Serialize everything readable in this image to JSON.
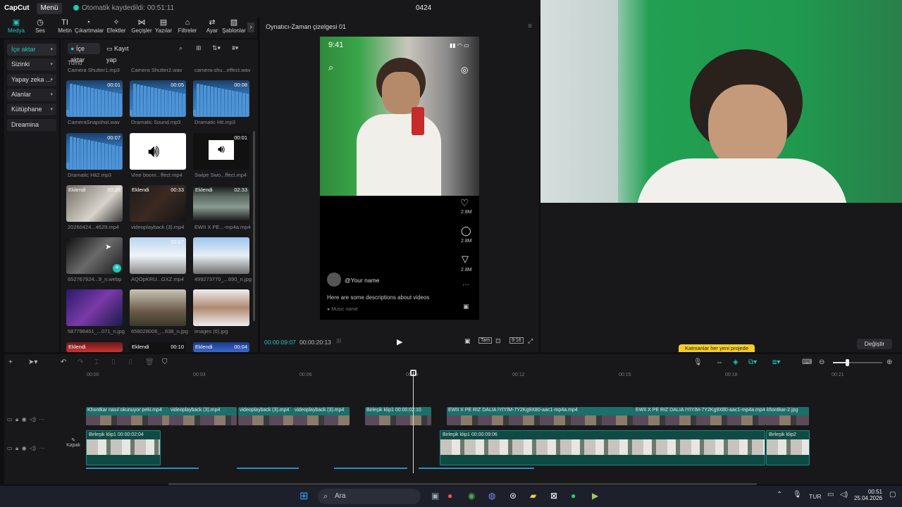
{
  "app": {
    "logo": "CapCut",
    "menu_label": "Menü",
    "autosave_text": "Otomatik kaydedildi: 00:51:11",
    "project_title": "0424"
  },
  "toolbar": {
    "tools": [
      {
        "label": "Medya",
        "icon": "media-icon",
        "glyph": "▣"
      },
      {
        "label": "Ses",
        "icon": "audio-icon",
        "glyph": "◷"
      },
      {
        "label": "Metin",
        "icon": "text-icon",
        "glyph": "TI"
      },
      {
        "label": "Çıkartmalar",
        "icon": "sticker-icon",
        "glyph": "◔"
      },
      {
        "label": "Efektler",
        "icon": "effects-icon",
        "glyph": "✧"
      },
      {
        "label": "Geçişler",
        "icon": "transitions-icon",
        "glyph": "⋈"
      },
      {
        "label": "Yazılar",
        "icon": "captions-icon",
        "glyph": "▤"
      },
      {
        "label": "Filtreler",
        "icon": "filters-icon",
        "glyph": "⌂"
      },
      {
        "label": "Ayar",
        "icon": "adjust-icon",
        "glyph": "⇄"
      },
      {
        "label": "Şablonlar",
        "icon": "templates-icon",
        "glyph": "▧"
      }
    ],
    "more_glyph": "›"
  },
  "leftnav": {
    "items": [
      {
        "label": "İçe aktar",
        "active": true
      },
      {
        "label": "Sizinki",
        "active": false
      },
      {
        "label": "Yapay zeka ...",
        "active": false
      },
      {
        "label": "Alanlar",
        "active": false
      },
      {
        "label": "Kütüphane",
        "active": false
      },
      {
        "label": "Dreamina",
        "active": false
      }
    ]
  },
  "media": {
    "import_label": "İçe aktar",
    "record_label": "Kayıt yap",
    "all_label": "Tümü",
    "top_names": [
      "Camera Shutter1.mp3",
      "Camera Shutter2.wav",
      "camera-shu...effect.wav"
    ],
    "items": [
      {
        "name": "CameraSnapshot.wav",
        "duration": "00:01",
        "kind": "wave",
        "added": ""
      },
      {
        "name": "Dramatic Sound.mp3",
        "duration": "00:05",
        "kind": "wave",
        "added": ""
      },
      {
        "name": "Dramatic Hit.mp3",
        "duration": "00:08",
        "kind": "wave",
        "added": ""
      },
      {
        "name": "Dramatic Hit2.mp3",
        "duration": "00:07",
        "kind": "wave",
        "added": ""
      },
      {
        "name": "Vine boom...ffect.mp4",
        "duration": "00:04",
        "kind": "speaker",
        "added": ""
      },
      {
        "name": "Swipe Swo...ffect.mp4",
        "duration": "00:01",
        "kind": "speaker-small",
        "added": ""
      },
      {
        "name": "20260424...4629.mp4",
        "duration": "00:26",
        "kind": "video-room",
        "added": "Eklendi"
      },
      {
        "name": "videoplayback (3).mp4",
        "duration": "00:33",
        "kind": "video-dark",
        "added": "Eklendi"
      },
      {
        "name": "EWII X PE...-mp4a.mp4",
        "duration": "02:33",
        "kind": "video-land",
        "added": "Eklendi"
      },
      {
        "name": "652767924...9_n.webp",
        "duration": "",
        "kind": "bw",
        "added": ""
      },
      {
        "name": "AQOpKRU...GXZ.mp4",
        "duration": "00:07",
        "kind": "snow",
        "added": ""
      },
      {
        "name": "499273770_...690_n.jpg",
        "duration": "",
        "kind": "snow2",
        "added": ""
      },
      {
        "name": "587798461_...071_n.jpg",
        "duration": "",
        "kind": "purple",
        "added": ""
      },
      {
        "name": "658028006_...638_n.jpg",
        "duration": "",
        "kind": "street",
        "added": ""
      },
      {
        "name": "images (6).jpg",
        "duration": "",
        "kind": "portrait",
        "added": ""
      },
      {
        "name": "",
        "duration": "",
        "kind": "red",
        "added": "Eklendi"
      },
      {
        "name": "",
        "duration": "00:10",
        "kind": "dark",
        "added": "Eklendi"
      },
      {
        "name": "",
        "duration": "00:04",
        "kind": "blue",
        "added": "Eklendi"
      }
    ]
  },
  "player": {
    "title": "Oynatıcı-Zaman çizelgesi 01",
    "phone_time": "9:41",
    "like_count": "2.8M",
    "comment_count": "2.8M",
    "share_count": "2.8M",
    "username": "@Your name",
    "description": "Here are some descriptions about videos",
    "music": "Music name",
    "current_time": "00:00:09:07",
    "total_time": "00:00:20:13",
    "controls": [
      "Tam",
      "9:16"
    ]
  },
  "rightpanel": {
    "tooltip": "Katmanlar her yeni projede",
    "change_button": "Değiştir"
  },
  "timeline": {
    "ruler": [
      "00:00",
      "00:03",
      "00:06",
      "00:09",
      "00:12",
      "00:15",
      "00:18",
      "00:21"
    ],
    "cover_label": "Kapak",
    "overlay_clips": [
      "Khontkar nasıl okunuyor peki.mp4",
      "videoplayback (3).mp4",
      "videoplayback (3).mp4",
      "videoplayback (3).mp4",
      "Birleşik klip1  00:00:02:10",
      "EWII X PE RIZ  DALIA İYİYİM-7Y2Kg9X80-aac1-mp4a.mp4",
      "EWII X PE RIZ  DALIA İYİYİM-7Y2Kg9X80-aac1-mp4a.mp4",
      "khontkar-2.jpg"
    ],
    "main_clips": [
      "Birleşik klip1  00:00:02:04",
      "Birleşik klip1  00:00:09:06",
      "Birleşik klip2"
    ]
  },
  "taskbar": {
    "search_placeholder": "Ara",
    "language": "TUR",
    "time": "00:51",
    "date": "25.04.2026"
  }
}
